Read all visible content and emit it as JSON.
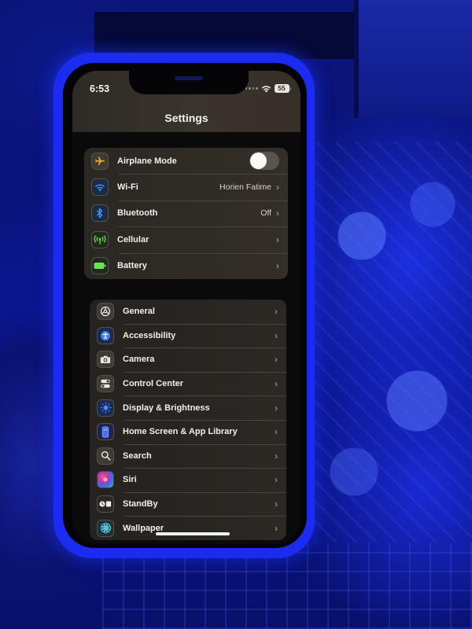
{
  "status_bar": {
    "time": "6:53",
    "battery_percent": "55",
    "icons": [
      "signal-dots-icon",
      "wifi-icon",
      "battery-icon"
    ]
  },
  "header": {
    "title": "Settings"
  },
  "groups": [
    {
      "items": [
        {
          "label": "Airplane Mode",
          "icon": "airplane-icon",
          "value": "",
          "control": "toggle",
          "toggle_on": false
        },
        {
          "label": "Wi-Fi",
          "icon": "wifi-icon",
          "value": "Horien Fatime",
          "control": "chevron"
        },
        {
          "label": "Bluetooth",
          "icon": "bluetooth-icon",
          "value": "Off",
          "control": "chevron"
        },
        {
          "label": "Cellular",
          "icon": "cellular-antenna-icon",
          "value": "",
          "control": "chevron"
        },
        {
          "label": "Battery",
          "icon": "battery-icon",
          "value": "",
          "control": "chevron"
        }
      ]
    },
    {
      "items": [
        {
          "label": "General",
          "icon": "gear-icon",
          "control": "chevron"
        },
        {
          "label": "Accessibility",
          "icon": "accessibility-icon",
          "control": "chevron"
        },
        {
          "label": "Camera",
          "icon": "camera-icon",
          "control": "chevron"
        },
        {
          "label": "Control Center",
          "icon": "toggles-icon",
          "control": "chevron"
        },
        {
          "label": "Display & Brightness",
          "icon": "sun-icon",
          "control": "chevron"
        },
        {
          "label": "Home Screen & App Library",
          "icon": "phone-screen-icon",
          "control": "chevron"
        },
        {
          "label": "Search",
          "icon": "search-icon",
          "control": "chevron"
        },
        {
          "label": "Siri",
          "icon": "siri-icon",
          "control": "chevron"
        },
        {
          "label": "StandBy",
          "icon": "standby-icon",
          "control": "chevron"
        },
        {
          "label": "Wallpaper",
          "icon": "flower-icon",
          "control": "chevron"
        }
      ]
    }
  ],
  "chevron_glyph": "›",
  "colors": {
    "case": "#1b2cf0",
    "airplane": "#f2a62a",
    "wifi": "#3a8cf0",
    "bluetooth": "#4a90f5",
    "cellular": "#6ee05a",
    "battery": "#6ee05a",
    "accessibility": "#3c7ef0",
    "display": "#4d8cf8",
    "home_screen": "#4b6cf0",
    "wallpaper": "#5ad2e8"
  }
}
